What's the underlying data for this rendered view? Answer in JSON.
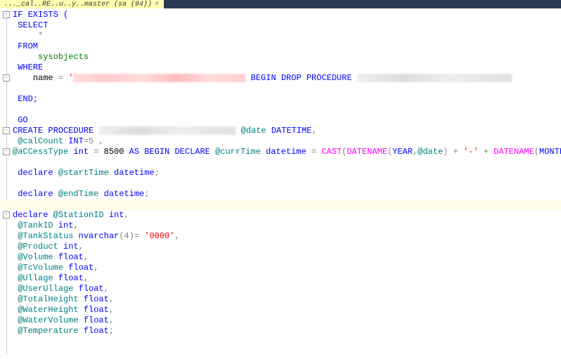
{
  "tab": {
    "title": "..._cal..RE..u..y..master (sa (94))",
    "close": "×"
  },
  "sql": {
    "if_exists": "IF EXISTS (",
    "select": "SELECT",
    "star": "*",
    "from": "FROM",
    "sysobjects": "sysobjects",
    "where": "WHERE",
    "name_eq": "name = '",
    "begin_drop": "BEGIN DROP PROCEDURE",
    "end": "END;",
    "go": "GO",
    "create_proc": "CREATE PROCEDURE",
    "param_date": "@date",
    "dt_datetime": "DATETIME",
    "param_calcount": "@calCount",
    "int_upper": "INT",
    "eq5": "=5 ,",
    "param_access": "@aCCessType",
    "int_lower": "int",
    "eq8500": "= 8500",
    "as_begin_declare": "AS BEGIN DECLARE",
    "curr_time": "@currTime",
    "dt_lower": "datetime",
    "eq": "=",
    "cast": "CAST",
    "datename": "DATENAME",
    "year": "YEAR",
    "month": "MONTH",
    "at_date": "@date",
    "dash": "'-'",
    "plus": "+",
    "declare": "declare",
    "start_time": "@startTime",
    "end_time": "@endTime",
    "station_id": "@StationID",
    "tank_id": "@TankID",
    "tank_status": "@TankStatus",
    "nvarchar": "nvarchar",
    "nv4": "(4)",
    "str0000": "'0000'",
    "product": "@Product",
    "volume": "@Volume",
    "float": "float",
    "tcvolume": "@TcVolume",
    "ullage": "@Ullage",
    "userullage": "@UserUllage",
    "totalheight": "@TotalHeight",
    "waterheight": "@WaterHeight",
    "watervolume": "@WaterVolume",
    "temperature": "@Temperature"
  }
}
